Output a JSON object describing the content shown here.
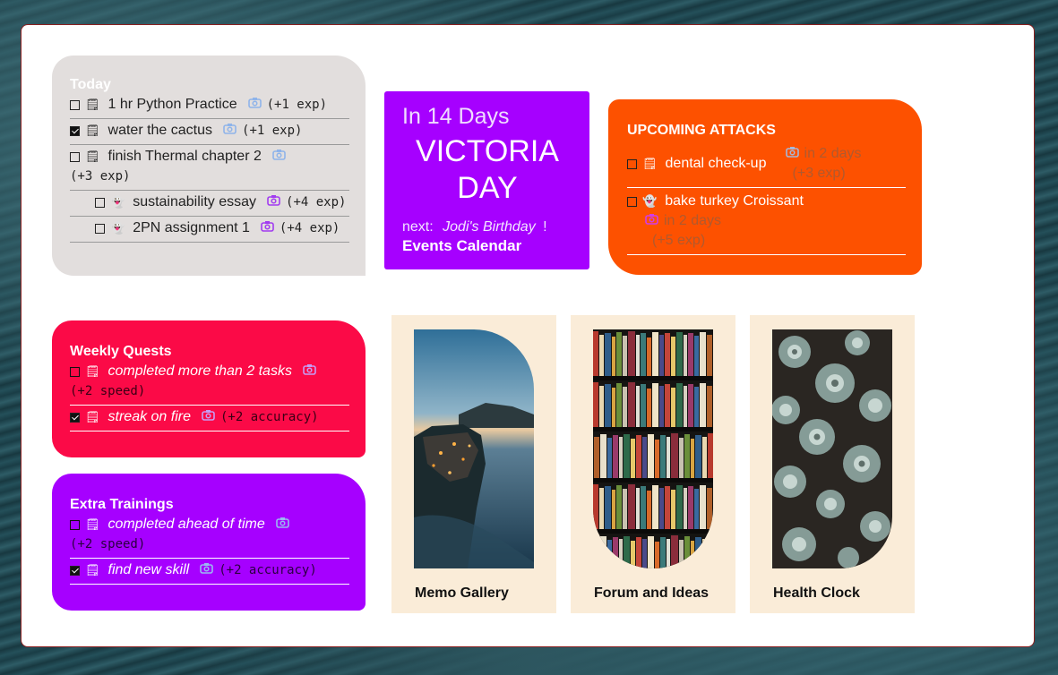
{
  "today": {
    "title": "Today",
    "tasks": [
      {
        "label": "1 hr Python Practice",
        "exp": "(+1 exp)"
      },
      {
        "label": "water the cactus",
        "exp": "(+1 exp)"
      },
      {
        "label": "finish Thermal chapter 2",
        "exp": "(+3 exp)"
      },
      {
        "label": "sustainability essay",
        "exp": "(+4 exp)"
      },
      {
        "label": "2PN assignment 1",
        "exp": "(+4 exp)"
      }
    ]
  },
  "weekly": {
    "title": "Weekly Quests",
    "items": [
      {
        "label": "completed more than 2 tasks",
        "reward": "(+2 speed)"
      },
      {
        "label": "streak on fire",
        "reward": "(+2 accuracy)"
      }
    ]
  },
  "extra": {
    "title": "Extra Trainings",
    "items": [
      {
        "label": "completed ahead of time",
        "reward": "(+2 speed)"
      },
      {
        "label": "find new skill",
        "reward": "(+2 accuracy)"
      }
    ]
  },
  "event": {
    "countdown": "In 14 Days",
    "name": "VICTORIA DAY",
    "next_prefix": "next:",
    "next_event": "Jodi's Birthday",
    "next_suffix": "!",
    "calendar_link": "Events Calendar"
  },
  "attacks": {
    "title": "UPCOMING ATTACKS",
    "items": [
      {
        "label": "dental check-up",
        "due": "in 2 days",
        "exp": "(+3 exp)"
      },
      {
        "label": "bake turkey Croissant",
        "due": "in 2 days",
        "exp": "(+5 exp)"
      }
    ]
  },
  "tiles": [
    {
      "label": "Memo Gallery"
    },
    {
      "label": "Forum and Ideas"
    },
    {
      "label": "Health Clock"
    }
  ],
  "colors": {
    "today_bg": "#e2dedd",
    "weekly_bg": "#fb0a47",
    "extra_bg": "#a600ff",
    "event_bg": "#a600ff",
    "attacks_bg": "#fd5100",
    "tile_bg": "#faecd8"
  },
  "icons": [
    "checkbox-icon",
    "clipboard-icon",
    "camera-icon",
    "ghost-icon"
  ]
}
